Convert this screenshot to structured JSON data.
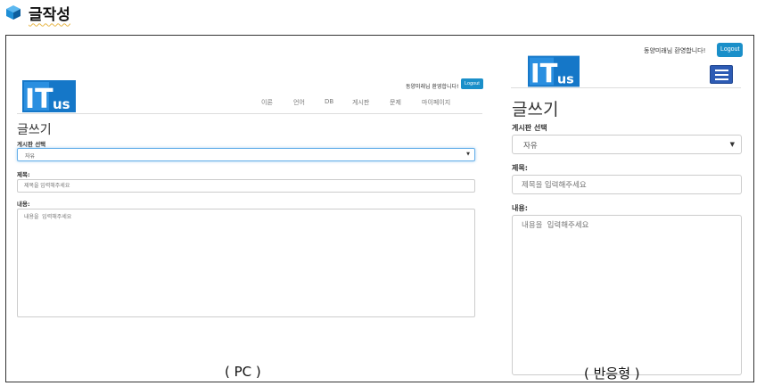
{
  "document": {
    "title": "글작성",
    "colors": {
      "cube": "#1f8fd6",
      "accent": "#1a8fc9",
      "menu": "#2d5bb4"
    }
  },
  "pc": {
    "logo_text": "ITus",
    "welcome": "동양미래님 환영합니다!",
    "logout": "Logout",
    "nav": [
      "이론",
      "언어",
      "DB",
      "게시판",
      "문제",
      "마이페이지"
    ],
    "heading": "글쓰기",
    "board_label": "게시판 선택",
    "board_value": "자유",
    "title_label": "제목:",
    "title_placeholder": "제목을 입력해주세요",
    "content_label": "내용:",
    "content_placeholder": "내용을 입력해주세요"
  },
  "mobile": {
    "logo_text": "ITus",
    "welcome": "동양미래님 환영합니다!",
    "logout": "Logout",
    "heading": "글쓰기",
    "board_label": "게시판 선택",
    "board_value": "자유",
    "title_label": "제목:",
    "title_placeholder": "제목을 입력해주세요",
    "content_label": "내용:",
    "content_placeholder": "내용을 입력해주세요"
  },
  "captions": {
    "pc": "( PC )",
    "mobile": "( 반응형 )"
  }
}
